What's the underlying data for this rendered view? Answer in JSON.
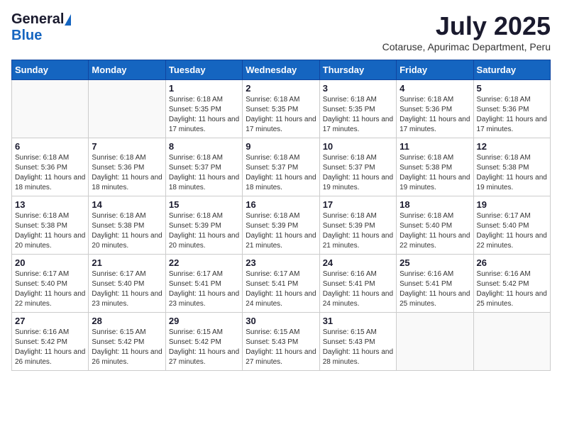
{
  "header": {
    "logo_general": "General",
    "logo_blue": "Blue",
    "main_title": "July 2025",
    "sub_title": "Cotaruse, Apurimac Department, Peru"
  },
  "calendar": {
    "days_of_week": [
      "Sunday",
      "Monday",
      "Tuesday",
      "Wednesday",
      "Thursday",
      "Friday",
      "Saturday"
    ],
    "weeks": [
      [
        {
          "day": "",
          "info": ""
        },
        {
          "day": "",
          "info": ""
        },
        {
          "day": "1",
          "info": "Sunrise: 6:18 AM\nSunset: 5:35 PM\nDaylight: 11 hours and 17 minutes."
        },
        {
          "day": "2",
          "info": "Sunrise: 6:18 AM\nSunset: 5:35 PM\nDaylight: 11 hours and 17 minutes."
        },
        {
          "day": "3",
          "info": "Sunrise: 6:18 AM\nSunset: 5:35 PM\nDaylight: 11 hours and 17 minutes."
        },
        {
          "day": "4",
          "info": "Sunrise: 6:18 AM\nSunset: 5:36 PM\nDaylight: 11 hours and 17 minutes."
        },
        {
          "day": "5",
          "info": "Sunrise: 6:18 AM\nSunset: 5:36 PM\nDaylight: 11 hours and 17 minutes."
        }
      ],
      [
        {
          "day": "6",
          "info": "Sunrise: 6:18 AM\nSunset: 5:36 PM\nDaylight: 11 hours and 18 minutes."
        },
        {
          "day": "7",
          "info": "Sunrise: 6:18 AM\nSunset: 5:36 PM\nDaylight: 11 hours and 18 minutes."
        },
        {
          "day": "8",
          "info": "Sunrise: 6:18 AM\nSunset: 5:37 PM\nDaylight: 11 hours and 18 minutes."
        },
        {
          "day": "9",
          "info": "Sunrise: 6:18 AM\nSunset: 5:37 PM\nDaylight: 11 hours and 18 minutes."
        },
        {
          "day": "10",
          "info": "Sunrise: 6:18 AM\nSunset: 5:37 PM\nDaylight: 11 hours and 19 minutes."
        },
        {
          "day": "11",
          "info": "Sunrise: 6:18 AM\nSunset: 5:38 PM\nDaylight: 11 hours and 19 minutes."
        },
        {
          "day": "12",
          "info": "Sunrise: 6:18 AM\nSunset: 5:38 PM\nDaylight: 11 hours and 19 minutes."
        }
      ],
      [
        {
          "day": "13",
          "info": "Sunrise: 6:18 AM\nSunset: 5:38 PM\nDaylight: 11 hours and 20 minutes."
        },
        {
          "day": "14",
          "info": "Sunrise: 6:18 AM\nSunset: 5:38 PM\nDaylight: 11 hours and 20 minutes."
        },
        {
          "day": "15",
          "info": "Sunrise: 6:18 AM\nSunset: 5:39 PM\nDaylight: 11 hours and 20 minutes."
        },
        {
          "day": "16",
          "info": "Sunrise: 6:18 AM\nSunset: 5:39 PM\nDaylight: 11 hours and 21 minutes."
        },
        {
          "day": "17",
          "info": "Sunrise: 6:18 AM\nSunset: 5:39 PM\nDaylight: 11 hours and 21 minutes."
        },
        {
          "day": "18",
          "info": "Sunrise: 6:18 AM\nSunset: 5:40 PM\nDaylight: 11 hours and 22 minutes."
        },
        {
          "day": "19",
          "info": "Sunrise: 6:17 AM\nSunset: 5:40 PM\nDaylight: 11 hours and 22 minutes."
        }
      ],
      [
        {
          "day": "20",
          "info": "Sunrise: 6:17 AM\nSunset: 5:40 PM\nDaylight: 11 hours and 22 minutes."
        },
        {
          "day": "21",
          "info": "Sunrise: 6:17 AM\nSunset: 5:40 PM\nDaylight: 11 hours and 23 minutes."
        },
        {
          "day": "22",
          "info": "Sunrise: 6:17 AM\nSunset: 5:41 PM\nDaylight: 11 hours and 23 minutes."
        },
        {
          "day": "23",
          "info": "Sunrise: 6:17 AM\nSunset: 5:41 PM\nDaylight: 11 hours and 24 minutes."
        },
        {
          "day": "24",
          "info": "Sunrise: 6:16 AM\nSunset: 5:41 PM\nDaylight: 11 hours and 24 minutes."
        },
        {
          "day": "25",
          "info": "Sunrise: 6:16 AM\nSunset: 5:41 PM\nDaylight: 11 hours and 25 minutes."
        },
        {
          "day": "26",
          "info": "Sunrise: 6:16 AM\nSunset: 5:42 PM\nDaylight: 11 hours and 25 minutes."
        }
      ],
      [
        {
          "day": "27",
          "info": "Sunrise: 6:16 AM\nSunset: 5:42 PM\nDaylight: 11 hours and 26 minutes."
        },
        {
          "day": "28",
          "info": "Sunrise: 6:15 AM\nSunset: 5:42 PM\nDaylight: 11 hours and 26 minutes."
        },
        {
          "day": "29",
          "info": "Sunrise: 6:15 AM\nSunset: 5:42 PM\nDaylight: 11 hours and 27 minutes."
        },
        {
          "day": "30",
          "info": "Sunrise: 6:15 AM\nSunset: 5:43 PM\nDaylight: 11 hours and 27 minutes."
        },
        {
          "day": "31",
          "info": "Sunrise: 6:15 AM\nSunset: 5:43 PM\nDaylight: 11 hours and 28 minutes."
        },
        {
          "day": "",
          "info": ""
        },
        {
          "day": "",
          "info": ""
        }
      ]
    ]
  }
}
